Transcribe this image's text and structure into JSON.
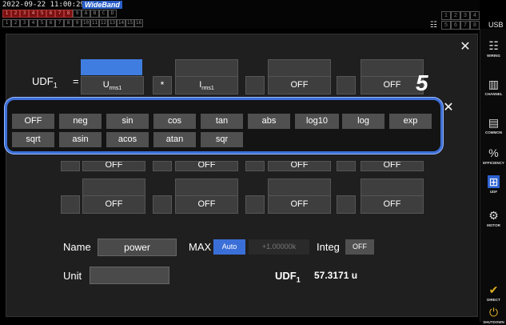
{
  "status": {
    "datetime": "2022-09-22 11:00:29",
    "mode": "WideBand",
    "usb": "USB",
    "channels_row1": [
      "1",
      "2",
      "3",
      "4",
      "5",
      "6",
      "7",
      "8",
      "9",
      "A",
      "B",
      "C",
      "D"
    ],
    "channels_row2": [
      "1",
      "2",
      "3",
      "4",
      "5",
      "6",
      "7",
      "8",
      "9",
      "10",
      "11",
      "12",
      "13",
      "14",
      "15",
      "16"
    ],
    "grid": [
      "1",
      "2",
      "3",
      "4",
      "5",
      "6",
      "7",
      "8"
    ]
  },
  "sidebar": {
    "items": [
      {
        "icon": "wiring-icon",
        "label": "WIRING"
      },
      {
        "icon": "channel-icon",
        "label": "CHANNEL"
      },
      {
        "icon": "common-icon",
        "label": "COMMON"
      },
      {
        "icon": "efficiency-icon",
        "label": "EFFICIENCY"
      },
      {
        "icon": "udf-icon",
        "label": "UDF"
      },
      {
        "icon": "motor-icon",
        "label": "MOTOR"
      },
      {
        "icon": "direct-icon",
        "label": "DIRECT"
      },
      {
        "icon": "shutdown-icon",
        "label": "SHUTDOWN"
      }
    ]
  },
  "editor": {
    "udf_label": "UDF",
    "udf_sub": "1",
    "equals": "=",
    "term1_main": "U",
    "term1_sub": "rms1",
    "operator1": "*",
    "term2_main": "I",
    "term2_sub": "rms1",
    "term3": "OFF",
    "term4": "OFF"
  },
  "step_marker": "5",
  "function_menu": {
    "row1": [
      "OFF",
      "neg",
      "sin",
      "cos",
      "tan",
      "abs",
      "log10",
      "log",
      "exp"
    ],
    "row2": [
      "sqrt",
      "asin",
      "acos",
      "atan",
      "sqr"
    ]
  },
  "rows": {
    "row3": [
      "OFF",
      "OFF",
      "OFF",
      "OFF"
    ],
    "row4": [
      "OFF",
      "OFF",
      "OFF",
      "OFF"
    ]
  },
  "settings": {
    "name_label": "Name",
    "name_value": "power",
    "max_label": "MAX",
    "max_mode": "Auto",
    "max_value": "+1.00000k",
    "integ_label": "Integ",
    "integ_value": "OFF",
    "unit_label": "Unit",
    "unit_value": "",
    "result_label": "UDF",
    "result_sub": "1",
    "result_value": "57.3171 u"
  },
  "colors": {
    "accent": "#3b6fd8",
    "panel": "#1f1f1f",
    "button": "#505050"
  }
}
